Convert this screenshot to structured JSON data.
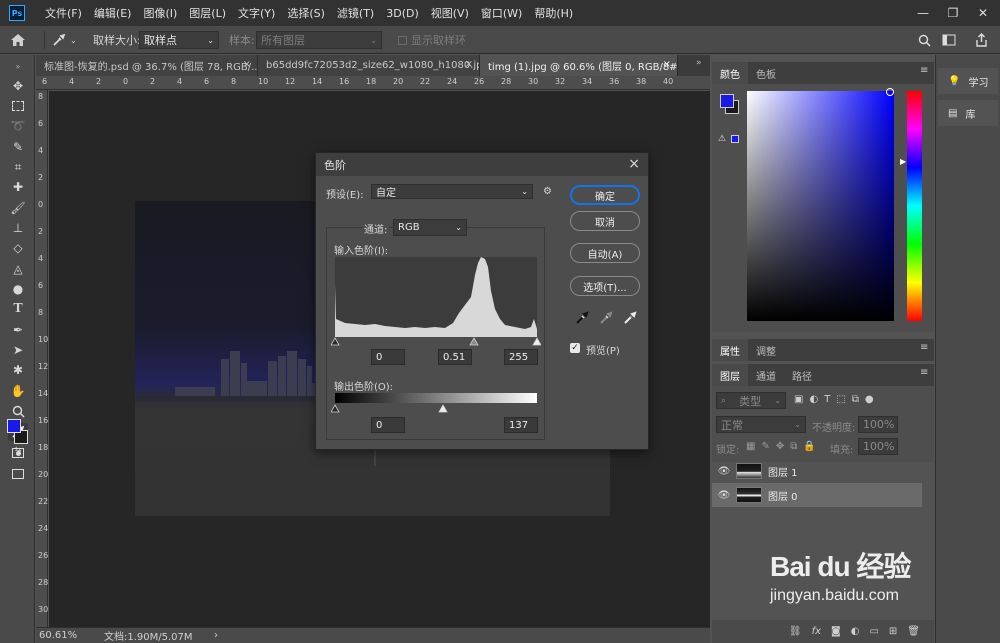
{
  "app": {
    "logo": "Ps"
  },
  "menu": [
    "文件(F)",
    "编辑(E)",
    "图像(I)",
    "图层(L)",
    "文字(Y)",
    "选择(S)",
    "滤镜(T)",
    "3D(D)",
    "视图(V)",
    "窗口(W)",
    "帮助(H)"
  ],
  "options": {
    "sample_size_label": "取样大小:",
    "sample_size_value": "取样点",
    "sample_label": "样本:",
    "sample_value": "所有图层",
    "show_ring_label": "显示取样环"
  },
  "tabs": [
    {
      "label": "标准图-恢复的.psd @ 36.7% (图层 78, RGB/...",
      "close": "×"
    },
    {
      "label": "b65dd9fc72053d2_size62_w1080_h1080.jpg",
      "close": "×"
    },
    {
      "label": "timg (1).jpg @ 60.6% (图层 0, RGB/8#) *",
      "close": "×"
    }
  ],
  "ruler_top": [
    "6",
    "4",
    "2",
    "0",
    "2",
    "4",
    "6",
    "8",
    "10",
    "12",
    "14",
    "16",
    "18",
    "20",
    "22",
    "24",
    "26",
    "28",
    "30",
    "32",
    "34",
    "36",
    "38",
    "40"
  ],
  "ruler_left": [
    "8",
    "6",
    "4",
    "2",
    "0",
    "2",
    "4",
    "6",
    "8",
    "10",
    "12",
    "14",
    "16",
    "18",
    "20",
    "22",
    "24",
    "26",
    "28",
    "30"
  ],
  "status": {
    "zoom": "60.61%",
    "doc": "文档:1.90M/5.07M",
    "arrow": "›"
  },
  "dialog": {
    "title": "色阶",
    "close": "×",
    "preset_label": "预设(E):",
    "preset_value": "自定",
    "channel_label": "通道:",
    "channel_value": "RGB",
    "input_label": "输入色阶(I):",
    "input_values": [
      "0",
      "0.51",
      "255"
    ],
    "output_label": "输出色阶(O):",
    "output_values": [
      "0",
      "137"
    ],
    "buttons": {
      "ok": "确定",
      "cancel": "取消",
      "auto": "自动(A)",
      "options": "选项(T)..."
    },
    "preview_label": "预览(P)",
    "preview_checked": true
  },
  "color_panel": {
    "tabs": [
      "颜色",
      "色板"
    ],
    "foreground": "#1a1ae6",
    "background": "#1a1a1a"
  },
  "props_panel": {
    "tabs": [
      "属性",
      "调整"
    ]
  },
  "layers_panel": {
    "tabs": [
      "图层",
      "通道",
      "路径"
    ],
    "filter_label": "类型",
    "blend_mode": "正常",
    "opacity_label": "不透明度:",
    "opacity_value": "100%",
    "lock_label": "锁定:",
    "fill_label": "填充:",
    "fill_value": "100%",
    "layers": [
      {
        "name": "图层 1",
        "visible": true,
        "selected": false
      },
      {
        "name": "图层 0",
        "visible": true,
        "selected": true
      }
    ],
    "bottom_icons": [
      "link-icon",
      "fx-icon",
      "mask-icon",
      "adjustment-icon",
      "group-icon",
      "new-layer-icon",
      "trash-icon"
    ]
  },
  "right_strip": {
    "learn": "学习",
    "library": "库"
  },
  "watermark": {
    "brand": "Bai du 经验",
    "url": "jingyan.baidu.com"
  }
}
